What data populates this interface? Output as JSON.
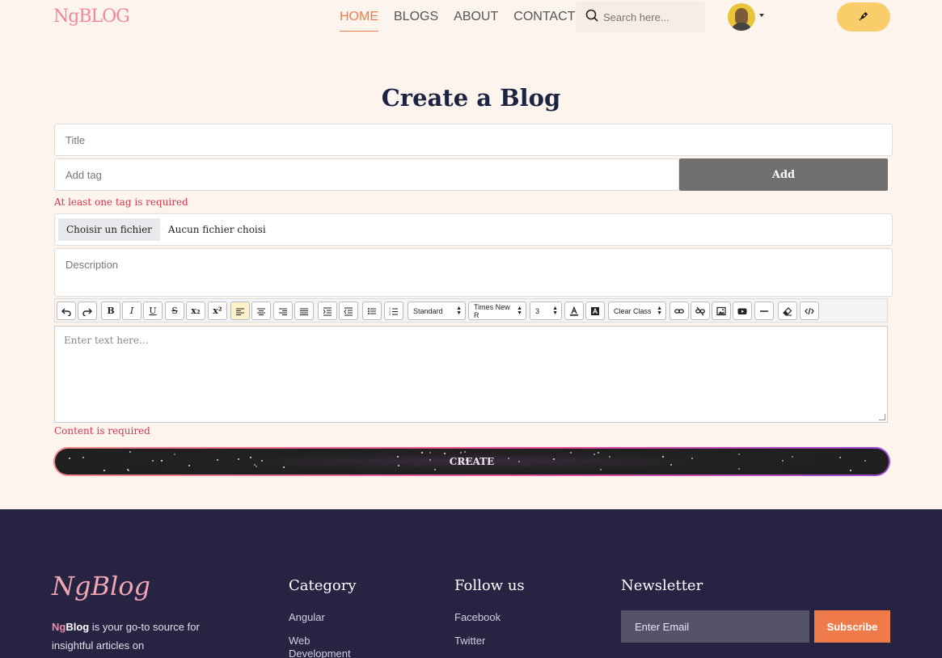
{
  "nav": {
    "logo": "NgBLOG",
    "links": [
      {
        "label": "HOME",
        "active": true
      },
      {
        "label": "BLOGS",
        "active": false
      },
      {
        "label": "ABOUT",
        "active": false
      },
      {
        "label": "CONTACT",
        "active": false
      }
    ],
    "search_placeholder": "Search here...",
    "accent": "#f07b4a"
  },
  "form": {
    "title": "Create a Blog",
    "title_placeholder": "Title",
    "tag_placeholder": "Add tag",
    "add_label": "Add",
    "tag_error": "At least one tag is required",
    "file_button": "Choisir un fichier",
    "file_status": "Aucun fichier choisi",
    "description_placeholder": "Description",
    "editor_placeholder": "Enter text here...",
    "content_error": "Content is required",
    "create_label": "CREATE"
  },
  "toolbar": {
    "bold": "B",
    "italic": "I",
    "underline": "U",
    "strike": "S",
    "subscript": "x₂",
    "superscript": "x²",
    "heading_select": "Standard",
    "font_select": "Times New R",
    "size_select": "3",
    "class_select": "Clear Class"
  },
  "footer": {
    "logo": "NgBlog",
    "desc_brand_ng": "Ng",
    "desc_brand_blog": "Blog",
    "desc_text": " is your go-to source for insightful articles on",
    "category_heading": "Category",
    "categories": [
      "Angular",
      "Web Development"
    ],
    "follow_heading": "Follow us",
    "follow": [
      "Facebook",
      "Twitter"
    ],
    "newsletter_heading": "Newsletter",
    "email_placeholder": "Enter Email",
    "subscribe_label": "Subscribe"
  }
}
